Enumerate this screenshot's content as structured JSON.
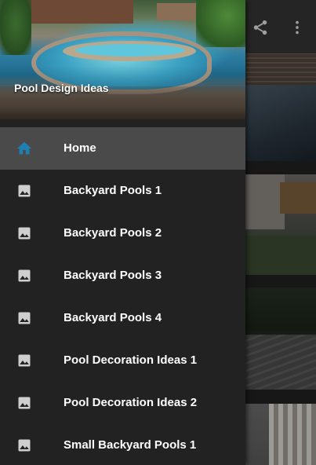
{
  "drawer": {
    "header_title": "Pool Design Ideas",
    "items": [
      {
        "label": "Home",
        "icon": "home-icon",
        "active": true
      },
      {
        "label": "Backyard Pools 1",
        "icon": "image-icon"
      },
      {
        "label": "Backyard Pools 2",
        "icon": "image-icon"
      },
      {
        "label": "Backyard Pools 3",
        "icon": "image-icon"
      },
      {
        "label": "Backyard Pools 4",
        "icon": "image-icon"
      },
      {
        "label": "Pool Decoration Ideas 1",
        "icon": "image-icon"
      },
      {
        "label": "Pool Decoration Ideas 2",
        "icon": "image-icon"
      },
      {
        "label": "Small Backyard Pools 1",
        "icon": "image-icon"
      }
    ]
  },
  "toolbar": {
    "actions": [
      {
        "icon": "share-icon"
      },
      {
        "icon": "more-vert-icon"
      }
    ]
  },
  "colors": {
    "drawer_bg": "#222222",
    "active_item_bg": "#4a4a4a",
    "home_icon": "#1f7fb3",
    "image_icon": "#cfcfcf",
    "text": "#ffffff"
  }
}
